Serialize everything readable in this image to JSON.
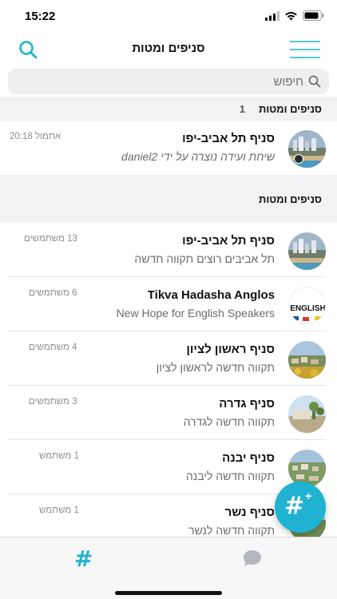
{
  "status_bar": {
    "time": "15:22"
  },
  "nav": {
    "title": "סניפים ומטות"
  },
  "search": {
    "placeholder": "חיפוש"
  },
  "recent_section": {
    "title": "סניפים ומטות",
    "count": "1"
  },
  "recent_chat": {
    "title": "סניף תל אביב-יפו",
    "subtitle_prefix": "שיחת ועידה נוצרה על ידי ",
    "subtitle_user": "daniel2",
    "time": "אתמול 20:18"
  },
  "main_section": {
    "title": "סניפים ומטות"
  },
  "branches": [
    {
      "title": "סניף תל אביב-יפו",
      "subtitle": "תל אביבים רוצים תקווה חדשה",
      "members": "13 משתמשים",
      "avatar": "tel-aviv-avatar"
    },
    {
      "title": "Tikva Hadasha Anglos",
      "subtitle": "New Hope for English Speakers",
      "members": "6 משתמשים",
      "avatar": "english-avatar"
    },
    {
      "title": "סניף ראשון לציון",
      "subtitle": "תקווה חדשה לראשון לציון",
      "members": "4 משתמשים",
      "avatar": "rishon-avatar"
    },
    {
      "title": "סניף גדרה",
      "subtitle": "תקווה חדשה לגדרה",
      "members": "3 משתמשים",
      "avatar": "gedera-avatar"
    },
    {
      "title": "סניף יבנה",
      "subtitle": "תקווה חדשה ליבנה",
      "members": "1 משתמש",
      "avatar": "yavne-avatar"
    },
    {
      "title": "סניף נשר",
      "subtitle": "תקווה חדשה לנשר",
      "members": "1 משתמש",
      "avatar": "nesher-avatar"
    }
  ],
  "english_avatar_text": "ENGLISH",
  "fab": {
    "icon": "#",
    "badge": "+"
  },
  "tabs": {
    "channels_icon": "#"
  },
  "colors": {
    "accent": "#1fb3d1",
    "section_bg": "#f2f2f4"
  }
}
